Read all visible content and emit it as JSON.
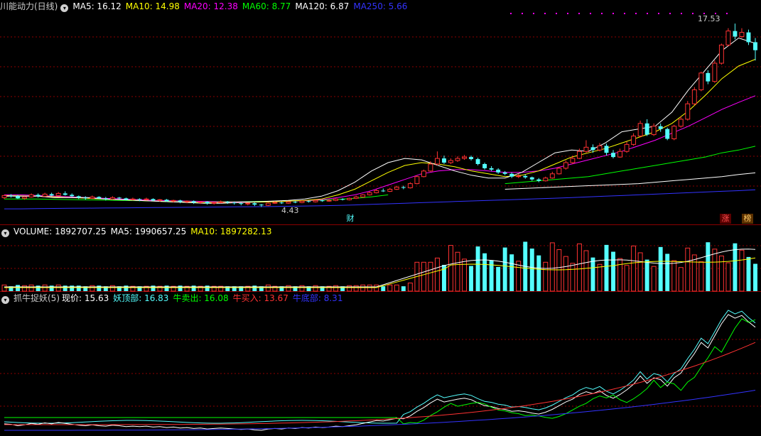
{
  "main": {
    "title": "川能动力(日线)",
    "ma": [
      {
        "label": "MA5: 16.12",
        "color": "#ffffff"
      },
      {
        "label": "MA10: 14.98",
        "color": "#ffff00"
      },
      {
        "label": "MA20: 12.38",
        "color": "#ff00ff"
      },
      {
        "label": "MA60: 8.77",
        "color": "#00ff00"
      },
      {
        "label": "MA120: 6.87",
        "color": "#ffffff"
      },
      {
        "label": "MA250: 5.66",
        "color": "#3333ff"
      }
    ],
    "high_label": "17.53",
    "low_label": "4.43",
    "marker_cai": "财",
    "marker_zhang": "涨",
    "marker_bang": "榜"
  },
  "volume": {
    "title": "VOLUME: 1892707.25",
    "ma5": "MA5: 1990657.25",
    "ma10": "MA10: 1897282.13"
  },
  "indicator": {
    "title": "抓牛捉妖(5)",
    "xianjia": "现价: 15.63",
    "yaodingbu": "妖顶部: 16.83",
    "niumaichu": "牛卖出: 16.08",
    "niumairu": "牛买入: 13.67",
    "niudibu": "牛底部: 8.31"
  },
  "colors": {
    "up": "#ff3232",
    "down": "#54ffff",
    "grid": "#8b0000",
    "ma5": "#ffffff",
    "ma10": "#ffff00",
    "ma20": "#ff00ff",
    "ma60": "#00ff00",
    "ma120": "#ffffff",
    "ma250": "#3333ff"
  },
  "chart_data": {
    "type": "candlestick",
    "ylim": [
      4.0,
      18.2
    ],
    "description_source": "daily candles read off the screenshot",
    "candles": [
      [
        5.1,
        5.25,
        5.3,
        5.0
      ],
      [
        5.25,
        5.2,
        5.35,
        5.1
      ],
      [
        5.2,
        5.05,
        5.3,
        5.0
      ],
      [
        5.05,
        5.15,
        5.2,
        4.95
      ],
      [
        5.15,
        5.3,
        5.4,
        5.1
      ],
      [
        5.3,
        5.2,
        5.4,
        5.1
      ],
      [
        5.2,
        5.35,
        5.45,
        5.15
      ],
      [
        5.35,
        5.25,
        5.45,
        5.2
      ],
      [
        5.25,
        5.4,
        5.5,
        5.2
      ],
      [
        5.4,
        5.3,
        5.55,
        5.25
      ],
      [
        5.3,
        5.2,
        5.4,
        5.15
      ],
      [
        5.2,
        5.1,
        5.25,
        5.0
      ],
      [
        5.1,
        5.05,
        5.2,
        4.95
      ],
      [
        5.05,
        5.15,
        5.25,
        5.0
      ],
      [
        5.15,
        5.05,
        5.2,
        5.0
      ],
      [
        5.05,
        5.0,
        5.15,
        4.9
      ],
      [
        5.0,
        5.1,
        5.2,
        4.95
      ],
      [
        5.1,
        5.05,
        5.15,
        4.95
      ],
      [
        5.05,
        4.95,
        5.1,
        4.9
      ],
      [
        4.95,
        5.0,
        5.1,
        4.9
      ],
      [
        5.0,
        4.95,
        5.05,
        4.85
      ],
      [
        4.95,
        5.0,
        5.1,
        4.9
      ],
      [
        5.0,
        4.9,
        5.05,
        4.85
      ],
      [
        4.9,
        4.95,
        5.0,
        4.8
      ],
      [
        4.95,
        4.85,
        5.0,
        4.8
      ],
      [
        4.85,
        4.9,
        4.95,
        4.75
      ],
      [
        4.9,
        4.8,
        4.95,
        4.7
      ],
      [
        4.8,
        4.85,
        4.9,
        4.7
      ],
      [
        4.85,
        4.75,
        4.9,
        4.65
      ],
      [
        4.75,
        4.8,
        4.85,
        4.65
      ],
      [
        4.8,
        4.7,
        4.85,
        4.6
      ],
      [
        4.7,
        4.75,
        4.8,
        4.6
      ],
      [
        4.75,
        4.8,
        4.9,
        4.7
      ],
      [
        4.8,
        4.75,
        4.85,
        4.65
      ],
      [
        4.75,
        4.7,
        4.8,
        4.6
      ],
      [
        4.7,
        4.65,
        4.75,
        4.55
      ],
      [
        4.65,
        4.7,
        4.75,
        4.55
      ],
      [
        4.7,
        4.6,
        4.75,
        4.5
      ],
      [
        4.6,
        4.55,
        4.65,
        4.43
      ],
      [
        4.55,
        4.7,
        4.75,
        4.5
      ],
      [
        4.7,
        4.75,
        4.85,
        4.65
      ],
      [
        4.75,
        4.7,
        4.8,
        4.65
      ],
      [
        4.7,
        4.8,
        4.85,
        4.65
      ],
      [
        4.8,
        4.75,
        4.85,
        4.7
      ],
      [
        4.75,
        4.85,
        4.9,
        4.7
      ],
      [
        4.85,
        4.8,
        4.9,
        4.75
      ],
      [
        4.8,
        4.9,
        4.95,
        4.75
      ],
      [
        4.9,
        4.85,
        4.95,
        4.8
      ],
      [
        4.85,
        4.9,
        5.0,
        4.8
      ],
      [
        4.9,
        5.0,
        5.05,
        4.85
      ],
      [
        5.0,
        4.95,
        5.05,
        4.9
      ],
      [
        4.95,
        5.05,
        5.1,
        4.9
      ],
      [
        5.05,
        5.15,
        5.25,
        5.0
      ],
      [
        5.15,
        5.3,
        5.35,
        5.1
      ],
      [
        5.3,
        5.45,
        5.55,
        5.25
      ],
      [
        5.45,
        5.6,
        5.7,
        5.4
      ],
      [
        5.6,
        5.55,
        5.75,
        5.5
      ],
      [
        5.55,
        5.7,
        5.8,
        5.5
      ],
      [
        5.7,
        5.85,
        5.95,
        5.65
      ],
      [
        5.85,
        5.8,
        5.95,
        5.7
      ],
      [
        5.8,
        6.1,
        6.2,
        5.75
      ],
      [
        6.1,
        6.6,
        6.7,
        6.05
      ],
      [
        6.6,
        7.0,
        7.1,
        6.55
      ],
      [
        7.0,
        7.5,
        7.7,
        6.95
      ],
      [
        7.5,
        7.9,
        8.4,
        7.4
      ],
      [
        7.9,
        7.6,
        8.1,
        7.5
      ],
      [
        7.6,
        7.75,
        7.9,
        7.5
      ],
      [
        7.75,
        7.9,
        8.05,
        7.65
      ],
      [
        7.9,
        8.0,
        8.15,
        7.8
      ],
      [
        8.0,
        7.85,
        8.1,
        7.75
      ],
      [
        7.85,
        7.5,
        7.95,
        7.4
      ],
      [
        7.5,
        7.2,
        7.6,
        7.1
      ],
      [
        7.2,
        7.1,
        7.35,
        7.0
      ],
      [
        7.1,
        6.9,
        7.2,
        6.8
      ],
      [
        6.9,
        6.8,
        7.0,
        6.7
      ],
      [
        6.8,
        6.6,
        6.9,
        6.5
      ],
      [
        6.6,
        6.65,
        6.8,
        6.5
      ],
      [
        6.65,
        6.55,
        6.75,
        6.45
      ],
      [
        6.55,
        6.4,
        6.6,
        6.3
      ],
      [
        6.4,
        6.3,
        6.5,
        6.2
      ],
      [
        6.3,
        6.5,
        6.6,
        6.25
      ],
      [
        6.5,
        6.8,
        6.95,
        6.45
      ],
      [
        6.8,
        7.2,
        7.3,
        6.75
      ],
      [
        7.2,
        7.6,
        7.75,
        7.1
      ],
      [
        7.6,
        7.9,
        8.1,
        7.5
      ],
      [
        7.9,
        8.4,
        8.6,
        7.85
      ],
      [
        8.4,
        8.7,
        9.2,
        8.3
      ],
      [
        8.7,
        8.5,
        8.9,
        8.3
      ],
      [
        8.5,
        8.8,
        9.0,
        8.4
      ],
      [
        8.8,
        8.3,
        8.95,
        8.1
      ],
      [
        8.3,
        8.0,
        8.5,
        7.9
      ],
      [
        8.0,
        8.4,
        8.6,
        7.95
      ],
      [
        8.4,
        8.9,
        9.1,
        8.3
      ],
      [
        8.9,
        9.5,
        9.7,
        8.8
      ],
      [
        9.5,
        10.4,
        10.6,
        9.4
      ],
      [
        10.4,
        9.6,
        10.7,
        9.5
      ],
      [
        9.6,
        10.2,
        10.4,
        9.5
      ],
      [
        10.2,
        10.0,
        10.4,
        9.8
      ],
      [
        10.0,
        9.3,
        10.1,
        9.2
      ],
      [
        9.3,
        10.2,
        10.3,
        9.2
      ],
      [
        10.2,
        10.7,
        10.9,
        10.1
      ],
      [
        10.7,
        11.8,
        12.0,
        10.6
      ],
      [
        11.8,
        12.8,
        13.0,
        11.7
      ],
      [
        12.8,
        14.0,
        14.1,
        12.7
      ],
      [
        14.0,
        13.4,
        14.2,
        13.2
      ],
      [
        13.4,
        14.7,
        14.9,
        13.3
      ],
      [
        14.7,
        16.0,
        16.1,
        14.6
      ],
      [
        16.0,
        17.0,
        17.2,
        15.9
      ],
      [
        17.0,
        16.6,
        17.53,
        16.4
      ],
      [
        16.6,
        16.9,
        17.2,
        16.5
      ],
      [
        16.9,
        16.2,
        17.1,
        16.0
      ],
      [
        16.2,
        15.63,
        16.5,
        14.9
      ]
    ],
    "ma5_line": [
      5.2,
      5.2,
      5.2,
      5.1,
      5.1,
      5.1,
      5.0,
      4.95,
      4.9,
      4.85,
      4.8,
      4.75,
      4.7,
      4.7,
      4.75,
      4.8,
      4.85,
      4.9,
      5.0,
      5.2,
      5.6,
      6.2,
      7.0,
      7.6,
      7.9,
      7.8,
      7.4,
      7.0,
      6.7,
      6.5,
      6.5,
      6.9,
      7.6,
      8.3,
      8.5,
      8.4,
      9.0,
      9.8,
      10.0,
      10.2,
      11.2,
      12.8,
      14.2,
      15.6,
      16.5,
      16.12
    ],
    "ma10_line": [
      5.25,
      5.22,
      5.2,
      5.15,
      5.1,
      5.05,
      5.0,
      4.95,
      4.9,
      4.85,
      4.8,
      4.78,
      4.75,
      4.75,
      4.75,
      4.78,
      4.8,
      4.85,
      4.9,
      5.0,
      5.3,
      5.7,
      6.3,
      6.9,
      7.4,
      7.6,
      7.5,
      7.3,
      7.0,
      6.8,
      6.6,
      6.7,
      7.0,
      7.5,
      8.0,
      8.3,
      8.6,
      9.0,
      9.4,
      9.8,
      10.4,
      11.3,
      12.4,
      13.6,
      14.5,
      14.98
    ],
    "ma20_line": [
      5.3,
      5.3,
      5.25,
      5.2,
      5.15,
      5.1,
      5.05,
      5.0,
      4.95,
      4.9,
      4.88,
      4.85,
      4.83,
      4.8,
      4.8,
      4.8,
      4.82,
      4.85,
      4.88,
      4.95,
      5.1,
      5.3,
      5.6,
      6.0,
      6.4,
      6.8,
      7.0,
      7.1,
      7.1,
      7.0,
      6.9,
      6.9,
      7.0,
      7.2,
      7.5,
      7.8,
      8.1,
      8.4,
      8.8,
      9.2,
      9.7,
      10.2,
      10.8,
      11.4,
      11.9,
      12.38
    ],
    "ma60_line": [
      5.0,
      5.0,
      5.0,
      4.98,
      4.96,
      4.94,
      4.92,
      4.9,
      4.88,
      4.86,
      4.85,
      4.84,
      4.83,
      4.82,
      4.82,
      4.83,
      4.84,
      4.86,
      4.88,
      4.92,
      4.98,
      5.05,
      5.15,
      5.3,
      null,
      null,
      null,
      null,
      null,
      null,
      6.1,
      6.2,
      6.3,
      6.4,
      6.5,
      6.6,
      6.8,
      7.0,
      7.2,
      7.4,
      7.6,
      7.8,
      8.0,
      8.3,
      8.5,
      8.77
    ],
    "ma120_line": [
      null,
      null,
      null,
      null,
      null,
      null,
      null,
      null,
      null,
      null,
      null,
      null,
      null,
      null,
      null,
      null,
      null,
      null,
      null,
      null,
      null,
      null,
      null,
      null,
      null,
      null,
      null,
      null,
      null,
      null,
      5.7,
      5.75,
      5.8,
      5.85,
      5.9,
      5.95,
      6.0,
      6.05,
      6.1,
      6.2,
      6.3,
      6.4,
      6.5,
      6.6,
      6.75,
      6.87
    ],
    "ma250_line": [
      4.3,
      4.3,
      4.32,
      4.33,
      4.34,
      4.35,
      4.36,
      4.37,
      4.38,
      4.39,
      4.4,
      4.41,
      4.42,
      4.43,
      4.44,
      4.45,
      4.46,
      4.48,
      4.5,
      4.52,
      4.55,
      4.58,
      4.62,
      4.66,
      4.7,
      4.74,
      4.78,
      4.82,
      4.86,
      4.9,
      4.94,
      4.98,
      5.02,
      5.06,
      5.1,
      5.15,
      5.2,
      5.25,
      5.3,
      5.35,
      5.4,
      5.45,
      5.5,
      5.55,
      5.6,
      5.66
    ]
  }
}
